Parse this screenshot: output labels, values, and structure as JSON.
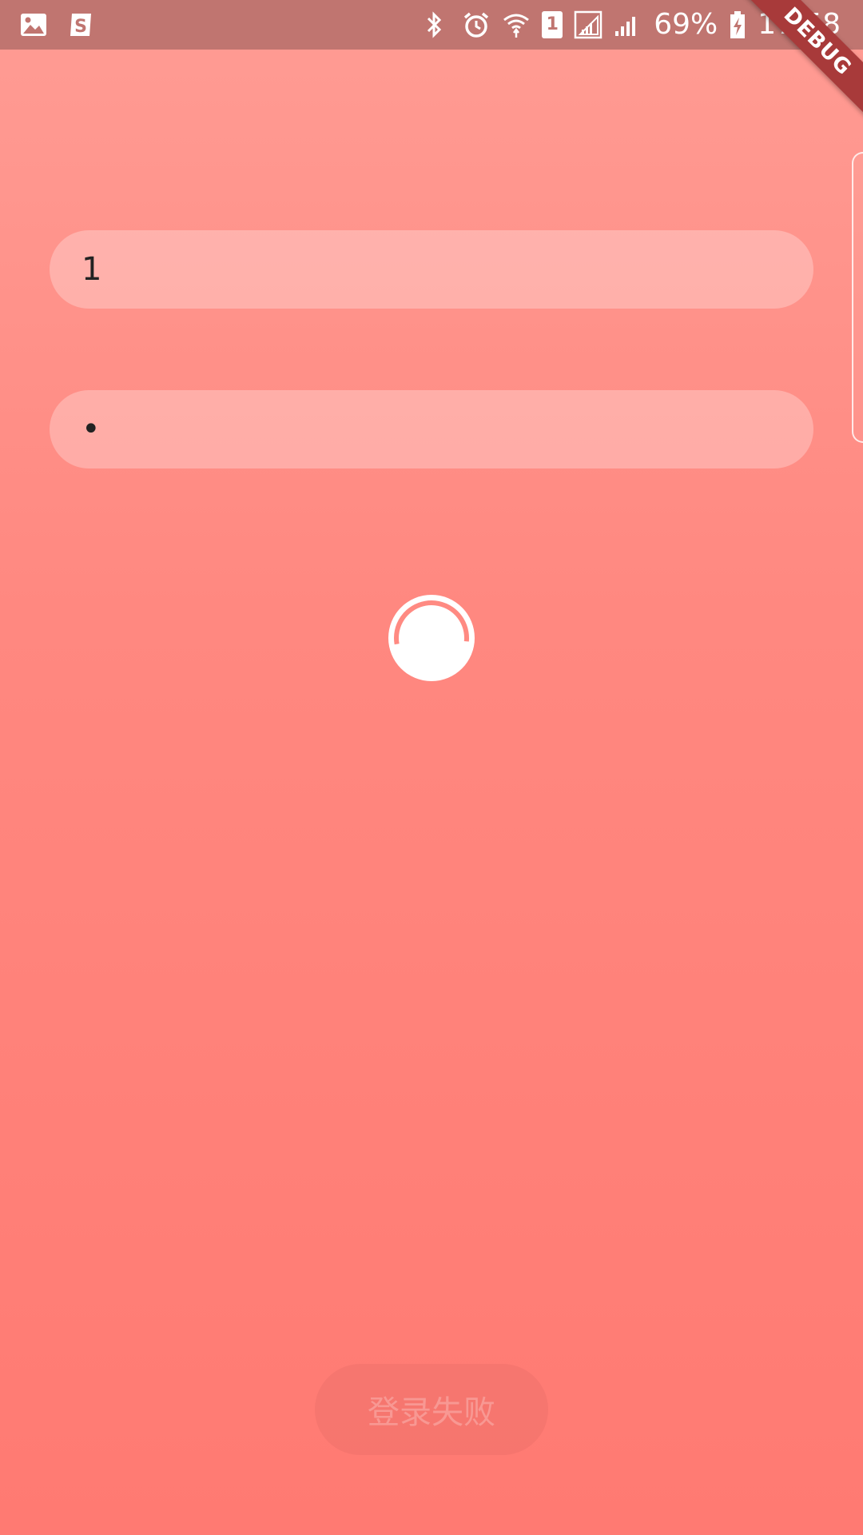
{
  "status_bar": {
    "icons_left": [
      "image-icon",
      "sogou-icon"
    ],
    "icons_right": [
      "bluetooth-icon",
      "alarm-icon",
      "wifi-icon",
      "sim-icon",
      "signal-icon",
      "signal-icon",
      "battery-icon"
    ],
    "sim_slot": "1",
    "battery_percent": "69%",
    "time": "17:58"
  },
  "debug_banner": "DEBUG",
  "form": {
    "username_value": "1",
    "password_value": "•"
  },
  "login_button": {
    "label": "登录失败"
  },
  "colors": {
    "background_top": "#ff9c94",
    "background_bottom": "#ff7a72",
    "status_bar": "#c07570",
    "ribbon": "#a83a3a"
  }
}
